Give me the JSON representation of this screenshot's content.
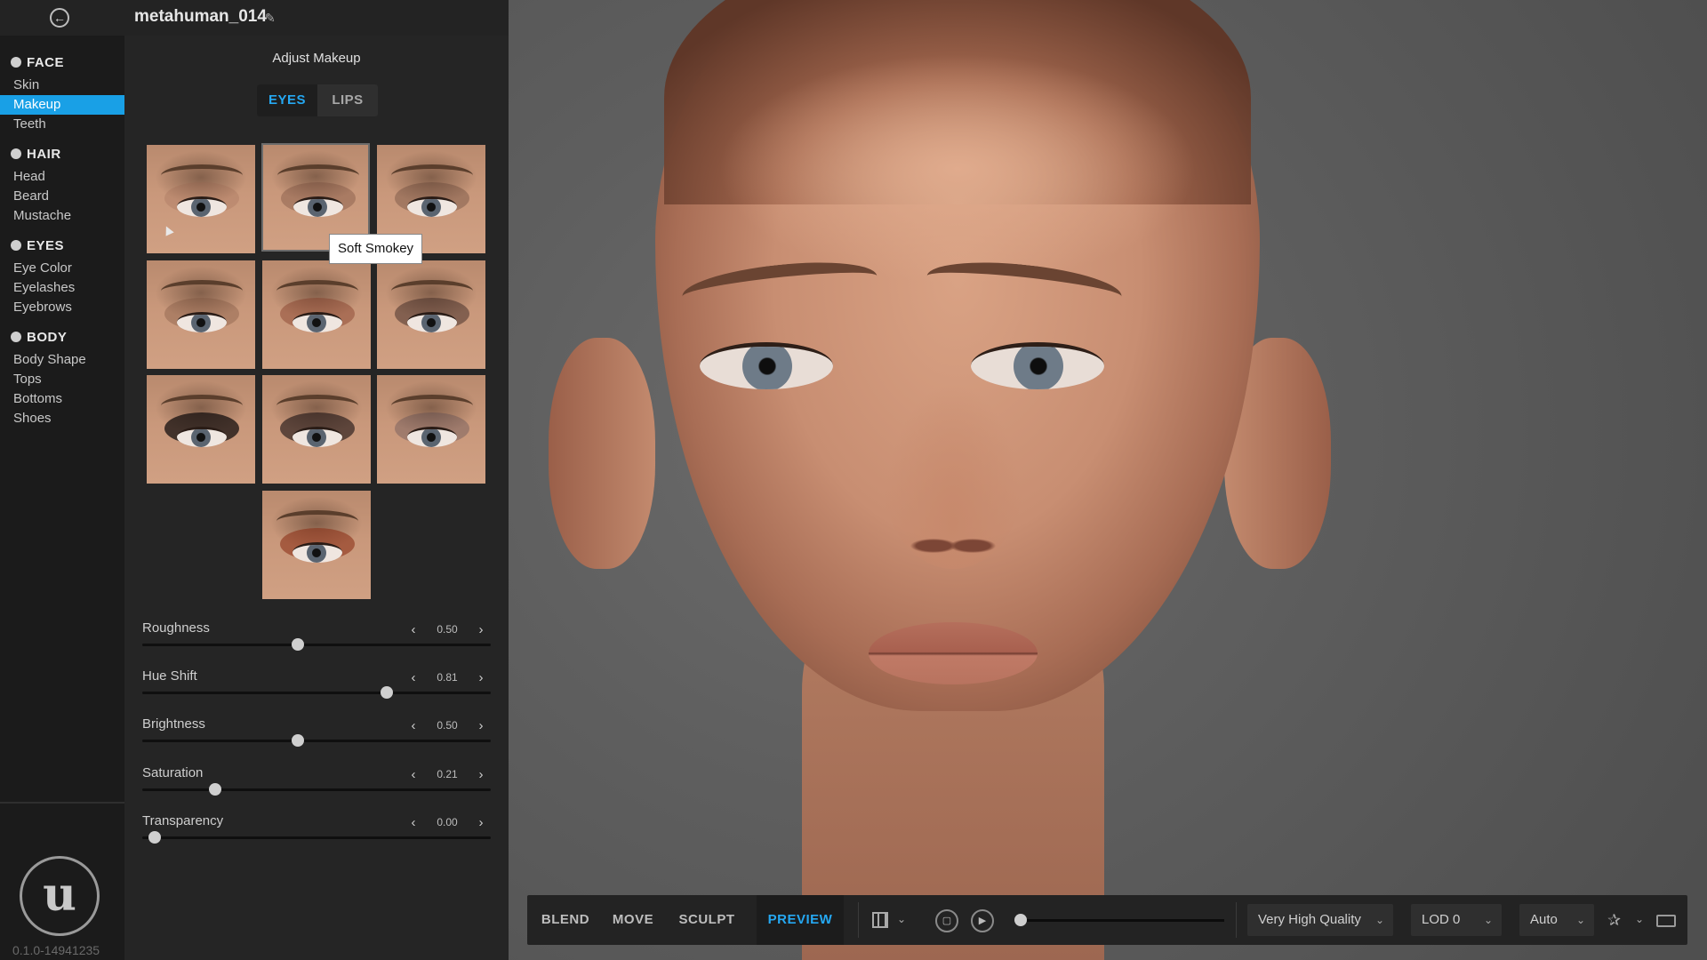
{
  "header": {
    "back_icon": "arrow-left-circle-icon",
    "character_name": "metahuman_014",
    "edit_icon": "pencil-icon"
  },
  "sidebar": {
    "categories": [
      {
        "label": "FACE",
        "icon": "face-icon",
        "items": [
          "Skin",
          "Makeup",
          "Teeth"
        ]
      },
      {
        "label": "HAIR",
        "icon": "hair-icon",
        "items": [
          "Head",
          "Beard",
          "Mustache"
        ]
      },
      {
        "label": "EYES",
        "icon": "eye-icon",
        "items": [
          "Eye Color",
          "Eyelashes",
          "Eyebrows"
        ]
      },
      {
        "label": "BODY",
        "icon": "body-icon",
        "items": [
          "Body Shape",
          "Tops",
          "Bottoms",
          "Shoes"
        ]
      }
    ],
    "active_item": "Makeup",
    "logo": "unreal-engine-logo",
    "version": "0.1.0-14941235"
  },
  "panel": {
    "title": "Adjust Makeup",
    "tabs": [
      {
        "label": "EYES",
        "active": true
      },
      {
        "label": "LIPS",
        "active": false
      }
    ],
    "preset_tooltip": "Soft Smokey",
    "preset_count": 10,
    "sliders": [
      {
        "label": "Roughness",
        "value": "0.50",
        "fraction": 0.5
      },
      {
        "label": "Hue Shift",
        "value": "0.81",
        "fraction": 0.81
      },
      {
        "label": "Brightness",
        "value": "0.50",
        "fraction": 0.5
      },
      {
        "label": "Saturation",
        "value": "0.21",
        "fraction": 0.21
      },
      {
        "label": "Transparency",
        "value": "0.00",
        "fraction": 0.0
      }
    ]
  },
  "toolbar": {
    "modes": [
      {
        "label": "BLEND"
      },
      {
        "label": "MOVE"
      },
      {
        "label": "SCULPT"
      },
      {
        "label": "PREVIEW",
        "active": true
      }
    ],
    "quality": "Very High Quality",
    "lod": "LOD 0",
    "auto": "Auto",
    "accent_color": "#25a8f2"
  },
  "colors": {
    "sidebar_active": "#19a0e6",
    "accent": "#25a8f2"
  }
}
